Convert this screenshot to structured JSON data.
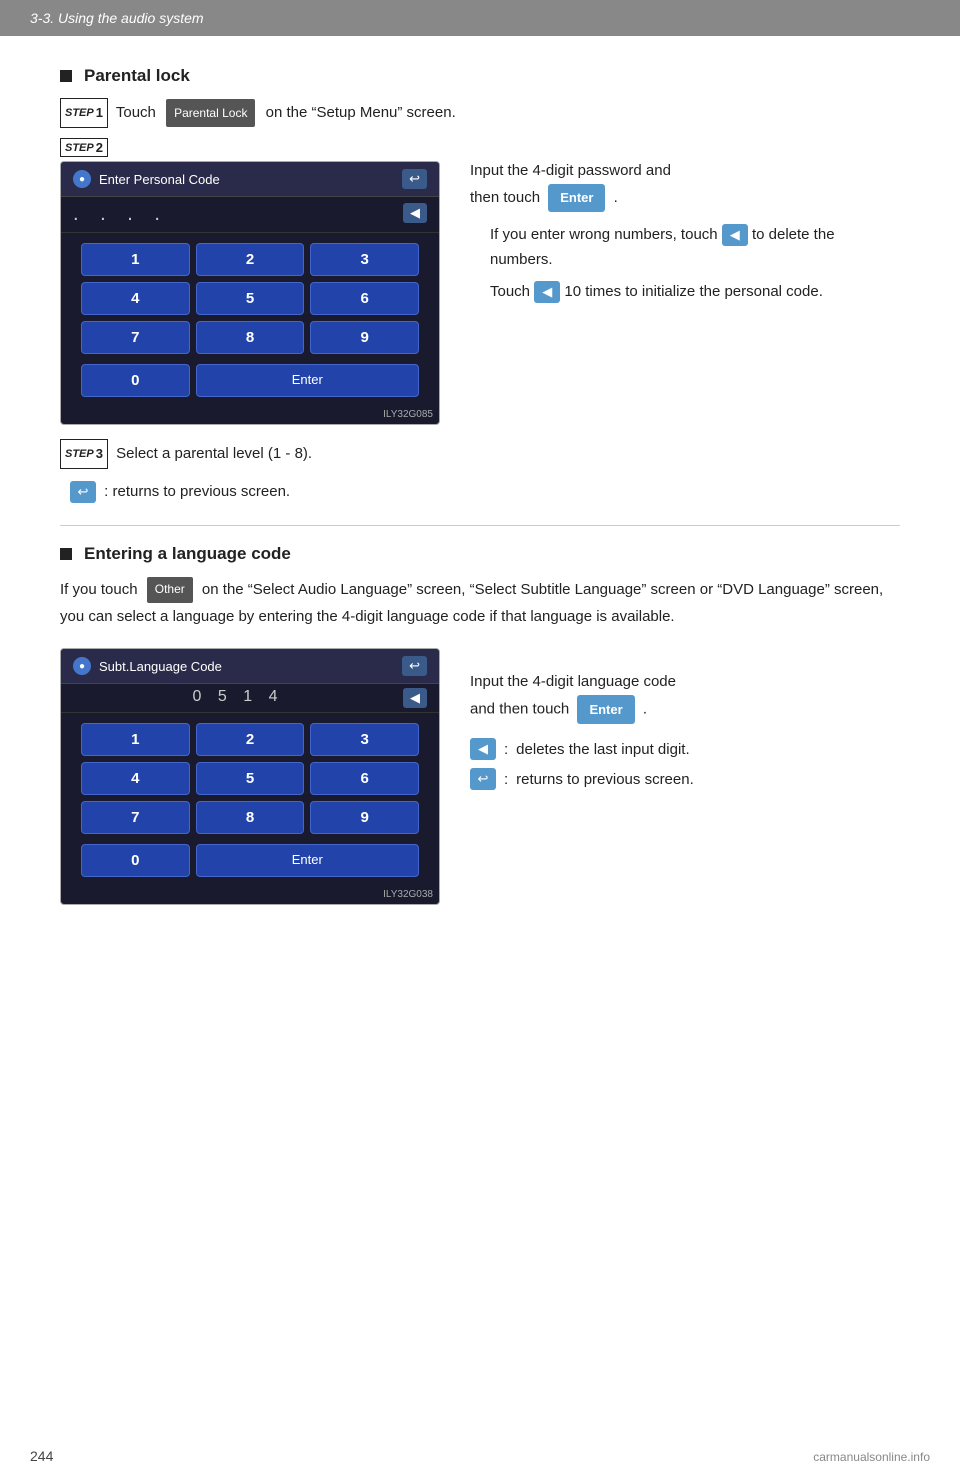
{
  "header": {
    "title": "3-3. Using the audio system"
  },
  "page_number": "244",
  "watermark": "carmanualsonline.info",
  "parental_lock": {
    "section_title": "Parental lock",
    "step1": {
      "badge": "STEP",
      "num": "1",
      "text": "Touch",
      "button_label": "Parental Lock",
      "suffix": "on the “Setup Menu” screen."
    },
    "step2": {
      "badge": "STEP",
      "num": "2",
      "screen": {
        "title": "Enter Personal Code",
        "dots": ". . . .",
        "keys": [
          "1",
          "2",
          "3",
          "4",
          "5",
          "6",
          "7",
          "8",
          "9",
          "0",
          "Enter"
        ],
        "watermark": "ILY32G085"
      },
      "text_line1": "Input  the  4-digit  password  and",
      "text_line2": "then touch",
      "enter_btn": "Enter",
      "text_line3": ".",
      "note1_prefix": "If you enter wrong numbers, touch",
      "note1_suffix": "to delete the numbers.",
      "note2_prefix": "Touch",
      "note2_num": "10",
      "note2_suffix": "times to initialize the personal code."
    },
    "step3": {
      "badge": "STEP",
      "num": "3",
      "text": "Select a parental level (1 - 8)."
    },
    "return_note": ":   returns to previous screen."
  },
  "language_code": {
    "section_title": "Entering a language code",
    "text": "If you touch",
    "other_btn": "Other",
    "text2": "on the “Select Audio Language” screen, “Select Subtitle Language” screen or “DVD Language” screen, you can select a language by entering the 4-digit language code if that language is available.",
    "screen": {
      "title": "Subt.Language Code",
      "num_display": "0 5 1 4",
      "keys": [
        "1",
        "2",
        "3",
        "4",
        "5",
        "6",
        "7",
        "8",
        "9",
        "0",
        "Enter"
      ],
      "watermark": "ILY32G038"
    },
    "text_line1": "Input  the  4-digit  language  code",
    "text_line2": "and then touch",
    "enter_btn": "Enter",
    "text_line3": ".",
    "note1_colon": ":",
    "note1_text": "deletes the last input digit.",
    "note2_colon": ":",
    "note2_text": "returns      to      previous screen."
  }
}
